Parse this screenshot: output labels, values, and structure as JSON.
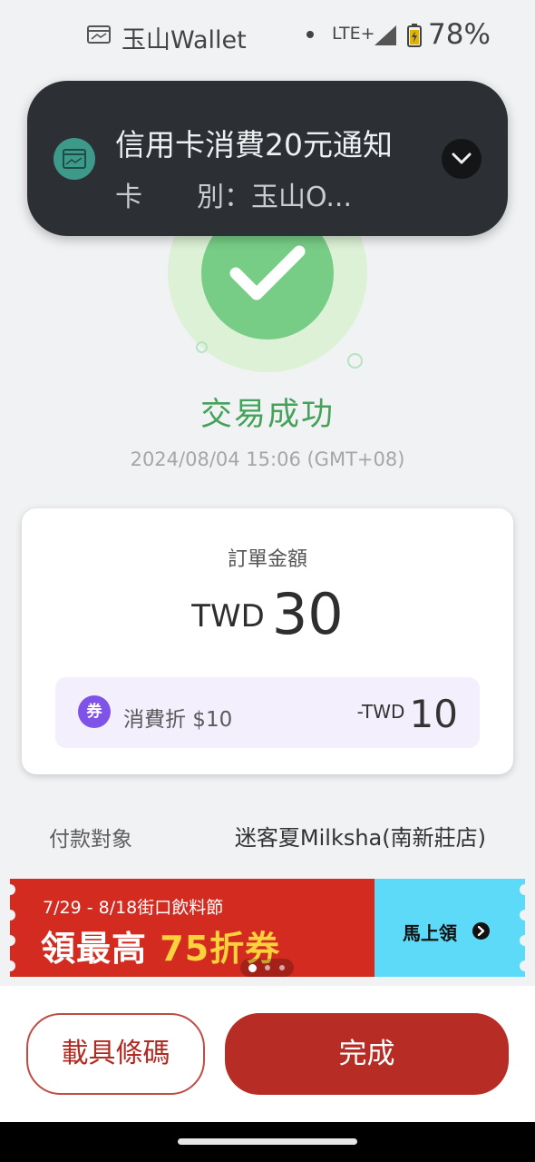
{
  "status_bar": {
    "app_icon": "wallet-icon",
    "app_name": "玉山Wallet",
    "network": "LTE+",
    "signal_icon": "signal-icon",
    "battery_icon": "battery-charging-icon",
    "battery_percent": "78%"
  },
  "notification": {
    "icon": "wallet-icon",
    "title": "信用卡消費20元通知",
    "body": "卡　　別：玉山O...",
    "expand_icon": "chevron-down-icon"
  },
  "result": {
    "icon": "check-icon",
    "title": "交易成功",
    "timestamp": "2024/08/04 15:06 (GMT+08)"
  },
  "order": {
    "label": "訂單金額",
    "currency": "TWD",
    "amount": "30",
    "discount": {
      "badge": "券",
      "label": "消費折 $10",
      "currency": "-TWD",
      "amount": "10"
    }
  },
  "payee": {
    "label": "付款對象",
    "value": "迷客夏Milksha(南新莊店)"
  },
  "promo": {
    "subtitle": "7/29 - 8/18街口飲料節",
    "title_prefix": "領最高",
    "title_highlight": "75折券",
    "cta": "馬上領",
    "cta_icon": "arrow-right-circle-icon",
    "page_count": 3,
    "active_page": 1,
    "colors": {
      "red": "#d32b20",
      "cyan": "#5cdaf7",
      "highlight": "#fbd13c"
    }
  },
  "actions": {
    "secondary": "載具條碼",
    "primary": "完成"
  },
  "colors": {
    "accent": "#b72d25",
    "success": "#45a25a",
    "discount_badge": "#7f52e8"
  }
}
